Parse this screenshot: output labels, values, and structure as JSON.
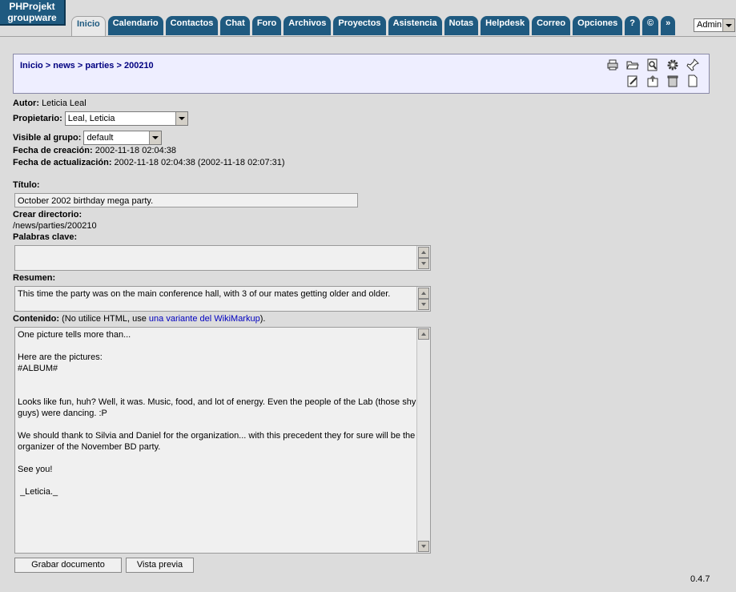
{
  "app": {
    "logo_line1": "PHProjekt",
    "logo_line2": "groupware",
    "version": "0.4.7"
  },
  "tabs": [
    {
      "label": "Inicio",
      "active": true
    },
    {
      "label": "Calendario"
    },
    {
      "label": "Contactos"
    },
    {
      "label": "Chat"
    },
    {
      "label": "Foro"
    },
    {
      "label": "Archivos"
    },
    {
      "label": "Proyectos"
    },
    {
      "label": "Asistencia"
    },
    {
      "label": "Notas"
    },
    {
      "label": "Helpdesk"
    },
    {
      "label": "Correo"
    },
    {
      "label": "Opciones"
    },
    {
      "label": "?"
    },
    {
      "label": "©"
    },
    {
      "label": "»"
    }
  ],
  "user_select": "Admin",
  "breadcrumb": {
    "home": "Inicio",
    "sep": " > ",
    "c1": "news",
    "c2": "parties",
    "c3": "200210"
  },
  "toolbar_icons": [
    "print-icon",
    "folder-open-icon",
    "search-icon",
    "gear-icon",
    "pin-icon",
    "edit-icon",
    "upload-icon",
    "trash-icon",
    "new-document-icon"
  ],
  "meta": {
    "author_label": "Autor:",
    "author_value": "Leticia Leal",
    "owner_label": "Propietario:",
    "owner_value": "Leal, Leticia",
    "group_label": "Visible al grupo:",
    "group_value": "default",
    "created_label": "Fecha de creación:",
    "created_value": "2002-11-18 02:04:38",
    "updated_label": "Fecha de actualización:",
    "updated_value": "2002-11-18 02:04:38 (2002-11-18 02:07:31)"
  },
  "form": {
    "title_label": "Título:",
    "title_value": "October 2002 birthday mega party.",
    "dir_label": "Crear directorio:",
    "dir_value": "/news/parties/200210",
    "keywords_label": "Palabras clave:",
    "keywords_value": "",
    "summary_label": "Resumen:",
    "summary_value": "This time the party was on the main conference hall, with 3 of our mates getting older and older.",
    "content_label": "Contenido:",
    "content_note_pre": "(No utilice HTML, use ",
    "content_note_link": "una variante del WikiMarkup",
    "content_note_post": ").",
    "content_value": "One picture tells more than...\n\nHere are the pictures:\n#ALBUM#\n\n\nLooks like fun, huh? Well, it was. Music, food, and lot of energy. Even the people of the Lab (those shy\nguys) were dancing. :P\n\nWe should thank to Silvia and Daniel for the organization... with this precedent they for sure will be the\norganizer of the November BD party.\n\nSee you!\n\n _Leticia._"
  },
  "buttons": {
    "save": "Grabar documento",
    "preview": "Vista previa"
  }
}
